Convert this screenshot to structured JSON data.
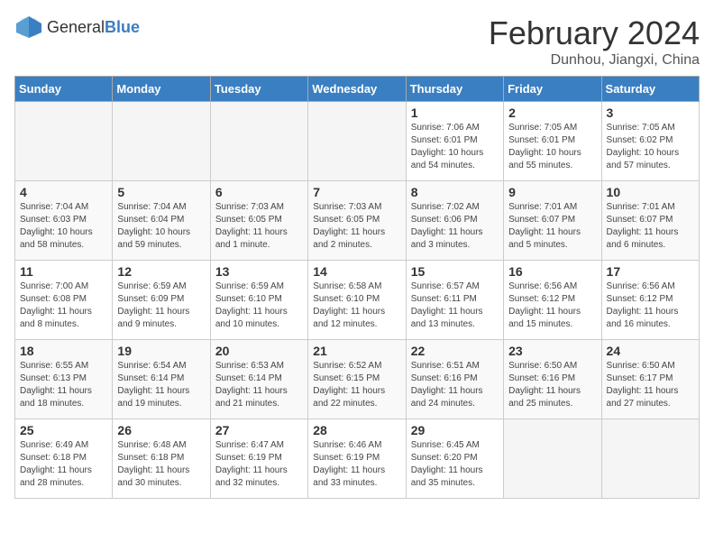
{
  "logo": {
    "general": "General",
    "blue": "Blue"
  },
  "title": "February 2024",
  "location": "Dunhou, Jiangxi, China",
  "weekdays": [
    "Sunday",
    "Monday",
    "Tuesday",
    "Wednesday",
    "Thursday",
    "Friday",
    "Saturday"
  ],
  "weeks": [
    [
      {
        "day": "",
        "info": ""
      },
      {
        "day": "",
        "info": ""
      },
      {
        "day": "",
        "info": ""
      },
      {
        "day": "",
        "info": ""
      },
      {
        "day": "1",
        "info": "Sunrise: 7:06 AM\nSunset: 6:01 PM\nDaylight: 10 hours\nand 54 minutes."
      },
      {
        "day": "2",
        "info": "Sunrise: 7:05 AM\nSunset: 6:01 PM\nDaylight: 10 hours\nand 55 minutes."
      },
      {
        "day": "3",
        "info": "Sunrise: 7:05 AM\nSunset: 6:02 PM\nDaylight: 10 hours\nand 57 minutes."
      }
    ],
    [
      {
        "day": "4",
        "info": "Sunrise: 7:04 AM\nSunset: 6:03 PM\nDaylight: 10 hours\nand 58 minutes."
      },
      {
        "day": "5",
        "info": "Sunrise: 7:04 AM\nSunset: 6:04 PM\nDaylight: 10 hours\nand 59 minutes."
      },
      {
        "day": "6",
        "info": "Sunrise: 7:03 AM\nSunset: 6:05 PM\nDaylight: 11 hours\nand 1 minute."
      },
      {
        "day": "7",
        "info": "Sunrise: 7:03 AM\nSunset: 6:05 PM\nDaylight: 11 hours\nand 2 minutes."
      },
      {
        "day": "8",
        "info": "Sunrise: 7:02 AM\nSunset: 6:06 PM\nDaylight: 11 hours\nand 3 minutes."
      },
      {
        "day": "9",
        "info": "Sunrise: 7:01 AM\nSunset: 6:07 PM\nDaylight: 11 hours\nand 5 minutes."
      },
      {
        "day": "10",
        "info": "Sunrise: 7:01 AM\nSunset: 6:07 PM\nDaylight: 11 hours\nand 6 minutes."
      }
    ],
    [
      {
        "day": "11",
        "info": "Sunrise: 7:00 AM\nSunset: 6:08 PM\nDaylight: 11 hours\nand 8 minutes."
      },
      {
        "day": "12",
        "info": "Sunrise: 6:59 AM\nSunset: 6:09 PM\nDaylight: 11 hours\nand 9 minutes."
      },
      {
        "day": "13",
        "info": "Sunrise: 6:59 AM\nSunset: 6:10 PM\nDaylight: 11 hours\nand 10 minutes."
      },
      {
        "day": "14",
        "info": "Sunrise: 6:58 AM\nSunset: 6:10 PM\nDaylight: 11 hours\nand 12 minutes."
      },
      {
        "day": "15",
        "info": "Sunrise: 6:57 AM\nSunset: 6:11 PM\nDaylight: 11 hours\nand 13 minutes."
      },
      {
        "day": "16",
        "info": "Sunrise: 6:56 AM\nSunset: 6:12 PM\nDaylight: 11 hours\nand 15 minutes."
      },
      {
        "day": "17",
        "info": "Sunrise: 6:56 AM\nSunset: 6:12 PM\nDaylight: 11 hours\nand 16 minutes."
      }
    ],
    [
      {
        "day": "18",
        "info": "Sunrise: 6:55 AM\nSunset: 6:13 PM\nDaylight: 11 hours\nand 18 minutes."
      },
      {
        "day": "19",
        "info": "Sunrise: 6:54 AM\nSunset: 6:14 PM\nDaylight: 11 hours\nand 19 minutes."
      },
      {
        "day": "20",
        "info": "Sunrise: 6:53 AM\nSunset: 6:14 PM\nDaylight: 11 hours\nand 21 minutes."
      },
      {
        "day": "21",
        "info": "Sunrise: 6:52 AM\nSunset: 6:15 PM\nDaylight: 11 hours\nand 22 minutes."
      },
      {
        "day": "22",
        "info": "Sunrise: 6:51 AM\nSunset: 6:16 PM\nDaylight: 11 hours\nand 24 minutes."
      },
      {
        "day": "23",
        "info": "Sunrise: 6:50 AM\nSunset: 6:16 PM\nDaylight: 11 hours\nand 25 minutes."
      },
      {
        "day": "24",
        "info": "Sunrise: 6:50 AM\nSunset: 6:17 PM\nDaylight: 11 hours\nand 27 minutes."
      }
    ],
    [
      {
        "day": "25",
        "info": "Sunrise: 6:49 AM\nSunset: 6:18 PM\nDaylight: 11 hours\nand 28 minutes."
      },
      {
        "day": "26",
        "info": "Sunrise: 6:48 AM\nSunset: 6:18 PM\nDaylight: 11 hours\nand 30 minutes."
      },
      {
        "day": "27",
        "info": "Sunrise: 6:47 AM\nSunset: 6:19 PM\nDaylight: 11 hours\nand 32 minutes."
      },
      {
        "day": "28",
        "info": "Sunrise: 6:46 AM\nSunset: 6:19 PM\nDaylight: 11 hours\nand 33 minutes."
      },
      {
        "day": "29",
        "info": "Sunrise: 6:45 AM\nSunset: 6:20 PM\nDaylight: 11 hours\nand 35 minutes."
      },
      {
        "day": "",
        "info": ""
      },
      {
        "day": "",
        "info": ""
      }
    ]
  ]
}
